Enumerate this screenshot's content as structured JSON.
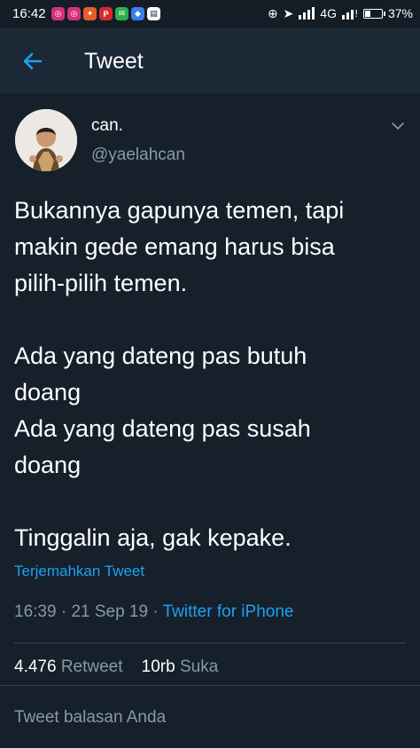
{
  "status_bar": {
    "time": "16:42",
    "network": "4G",
    "battery": "37%",
    "battery_level": 0.37,
    "notification_icons": [
      "instagram-icon",
      "instagram-icon",
      "messenger-icon",
      "pinterest-icon",
      "message-icon",
      "maps-icon",
      "video-icon"
    ]
  },
  "header": {
    "title": "Tweet"
  },
  "tweet": {
    "display_name": "can.",
    "handle": "@yaelahcan",
    "text_lines": [
      "Bukannya gapunya temen, tapi",
      "makin gede emang harus bisa",
      "pilih-pilih temen.",
      "",
      "Ada yang dateng pas butuh",
      "doang",
      "Ada yang dateng pas susah",
      "doang",
      "",
      "Tinggalin aja, gak kepake."
    ],
    "translate_label": "Terjemahkan Tweet",
    "time": "16:39",
    "date": "21 Sep 19",
    "source": "Twitter for iPhone",
    "separator": "·"
  },
  "stats": {
    "retweets": "4.476",
    "retweets_label": "Retweet",
    "likes": "10rb",
    "likes_label": "Suka"
  },
  "reply": {
    "placeholder": "Tweet balasan Anda"
  },
  "colors": {
    "background": "#15202b",
    "header": "#1b2836",
    "accent": "#1da1f2",
    "secondary_text": "#8899a6"
  }
}
